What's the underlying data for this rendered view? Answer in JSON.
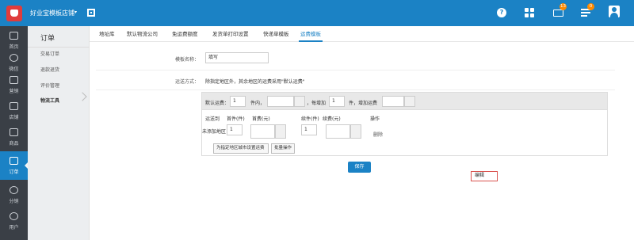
{
  "header": {
    "store_name": "好业宝模板店铺",
    "caret": "▾",
    "help": "?",
    "mail_badge": "13",
    "task_badge": "0"
  },
  "sidebar": {
    "items": [
      {
        "label": "首页"
      },
      {
        "label": "微信"
      },
      {
        "label": "营销"
      },
      {
        "label": "店铺"
      },
      {
        "label": "商品"
      },
      {
        "label": "订单"
      },
      {
        "label": "分销"
      },
      {
        "label": "用户"
      }
    ]
  },
  "subnav": {
    "title": "订单",
    "items": [
      {
        "label": "交易订单"
      },
      {
        "label": "退款退货"
      },
      {
        "label": "评价管理"
      },
      {
        "label": "物流工具"
      }
    ]
  },
  "tabs": [
    {
      "label": "地址库"
    },
    {
      "label": "默认物流公司"
    },
    {
      "label": "免运费额度"
    },
    {
      "label": "发货单打印设置"
    },
    {
      "label": "快递单模板"
    },
    {
      "label": "运费模板"
    }
  ],
  "form": {
    "template_name_label": "模板名称：",
    "template_name_value": "填写",
    "shipping_label": "运送方式：",
    "shipping_hint": "除指定地区外，其余地区的运费采用\"默认运费\"",
    "default": {
      "label": "默认运费：",
      "first_value": "1",
      "unit_within": "件内，",
      "each_add_label": "，每增加",
      "each_add_value": "1",
      "unit_add": "件，增加运费"
    },
    "columns": {
      "region": "运送到",
      "first": "首件(件)",
      "first_fee": "首费(元)",
      "continue": "续件(件)",
      "continue_fee": "续费(元)",
      "action": "操作"
    },
    "row": {
      "region": "未添加地区",
      "first_value": "1",
      "continue_value": "1",
      "delete": "删除",
      "edit": "编辑"
    },
    "set_city_button": "为指定地区城市设置运费",
    "batch_button": "批量操作",
    "save_button": "保存"
  }
}
